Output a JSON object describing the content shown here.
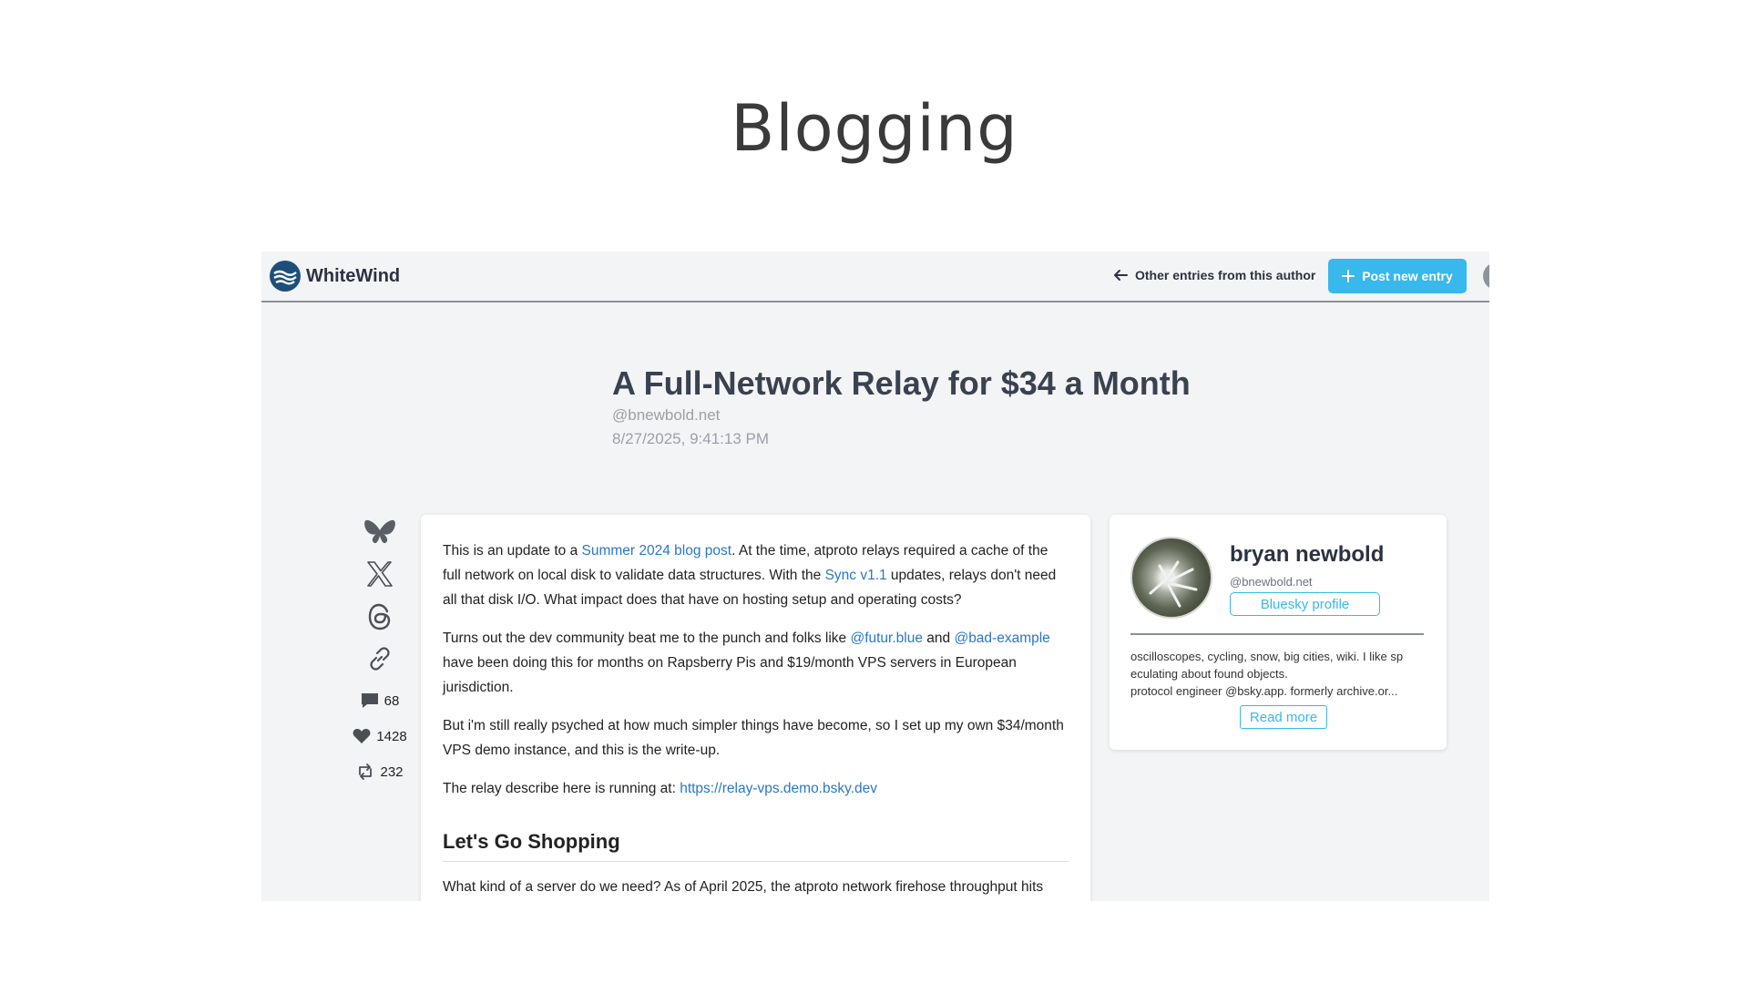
{
  "slide": {
    "title": "Blogging"
  },
  "topbar": {
    "app_name": "WhiteWind",
    "logo_icon": "whitewind-logo-icon",
    "other_entries_label": "Other entries from this author",
    "post_new_label": "Post new entry",
    "accent_color": "#38b8ec"
  },
  "article": {
    "title": "A Full-Network Relay for $34 a Month",
    "handle": "@bnewbold.net",
    "date": "8/27/2025, 9:41:13 PM",
    "p1": {
      "t1": "This is an update to a ",
      "link1": "Summer 2024 blog post",
      "t2": ". At the time, atproto relays required a cache of the full network on local disk to validate data structures. With the ",
      "link2": "Sync v1.1",
      "t3": " updates, relays don't need all that disk I/O. What impact does that have on hosting setup and operating costs?"
    },
    "p2": {
      "t1": "Turns out the dev community beat me to the punch and folks like ",
      "link1": "@futur.blue",
      "t2": " and ",
      "link2": "@bad-example",
      "t3": " have been doing this for months on Rapsberry Pis and $19/month VPS servers in European jurisdiction."
    },
    "p3": "But i'm still really psyched at how much simpler things have become, so I set up my own $34/month VPS demo instance, and this is the write-up.",
    "p4": {
      "t1": "The relay describe here is running at: ",
      "link1": "https://relay-vps.demo.bsky.dev"
    },
    "heading": "Let's Go Shopping",
    "p5": "What kind of a server do we need? As of April 2025, the atproto network firehose throughput hits"
  },
  "share": {
    "icons": [
      "bluesky-butterfly-icon",
      "x-icon",
      "threads-icon",
      "link-icon"
    ],
    "comments": "68",
    "likes": "1428",
    "reposts": "232"
  },
  "profile": {
    "name": "bryan newbold",
    "handle": "@bnewbold.net",
    "bsky_button": "Bluesky profile",
    "bio_line1": "oscilloscopes, cycling, snow, big cities, wiki. I like sp",
    "bio_line2": "eculating about found objects.",
    "bio_line3": "protocol engineer @bsky.app. formerly archive.or...",
    "read_more": "Read more"
  }
}
